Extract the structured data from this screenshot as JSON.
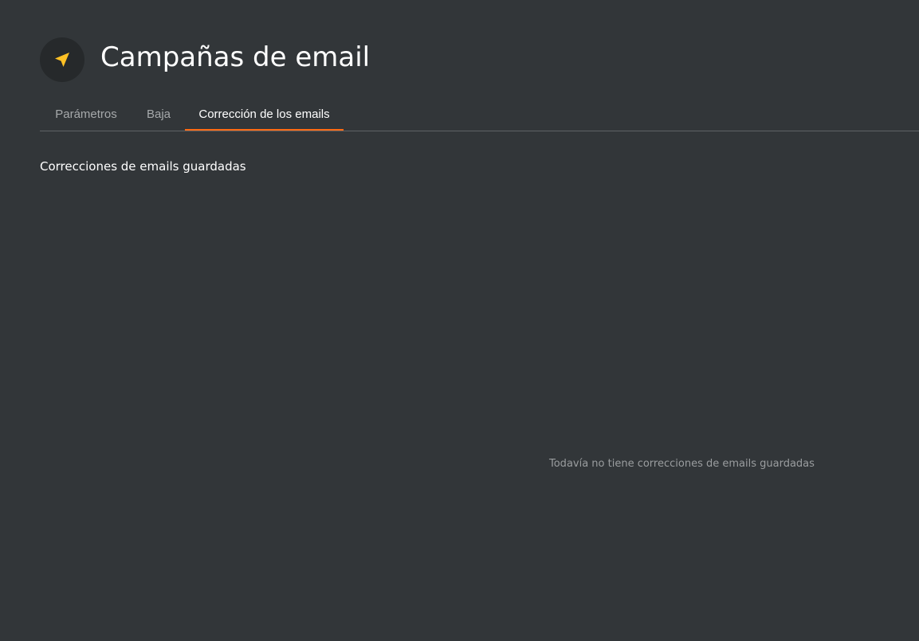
{
  "header": {
    "icon": "paper-plane-icon",
    "title": "Campañas de email",
    "icon_color": "#ffc125"
  },
  "tabs": [
    {
      "label": "Parámetros",
      "active": false
    },
    {
      "label": "Baja",
      "active": false
    },
    {
      "label": "Corrección de los emails",
      "active": true
    }
  ],
  "accent_color": "#ff6a13",
  "section": {
    "title": "Correcciones de emails guardadas",
    "empty_message": "Todavía no tiene correcciones de emails guardadas"
  }
}
